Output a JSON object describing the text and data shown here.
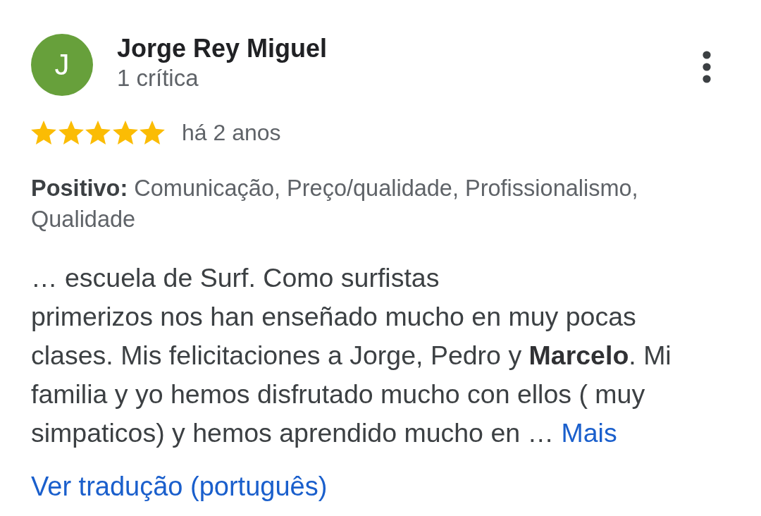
{
  "review": {
    "author": {
      "initial": "J",
      "name": "Jorge Rey Miguel",
      "review_count": "1 crítica"
    },
    "stars": 5,
    "time": "há 2 anos",
    "highlights": "**Positivo:** Comunicação, Preço/qualidade, Profissionalismo, Qualidade",
    "text": "… escuela de Surf. Como surfistas\nprimerizos nos han enseñado mucho en muy pocas clases. Mis felicitaciones a Jorge, Pedro y **Marcelo**. Mi familia y yo hemos disfrutado mucho con ellos ( muy simpaticos) y hemos aprendido mucho en …",
    "more_link": "Mais",
    "translate_link": "Ver tradução (português)"
  }
}
